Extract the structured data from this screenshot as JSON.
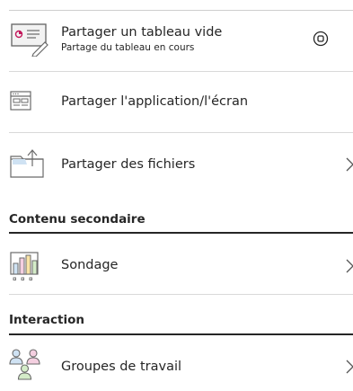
{
  "share": {
    "items": [
      {
        "label": "Partager un tableau vide",
        "sublabel": "Partage du tableau en cours",
        "icon": "whiteboard-icon",
        "action_icon": "stop-sharing-icon"
      },
      {
        "label": "Partager l'application/l'écran",
        "icon": "application-window-icon"
      },
      {
        "label": "Partager des fichiers",
        "icon": "folder-upload-icon",
        "action_icon": "chevron-right-icon"
      }
    ]
  },
  "secondary_content": {
    "heading": "Contenu secondaire",
    "items": [
      {
        "label": "Sondage",
        "icon": "poll-chart-icon",
        "action_icon": "chevron-right-icon"
      }
    ]
  },
  "interaction": {
    "heading": "Interaction",
    "items": [
      {
        "label": "Groupes de travail",
        "icon": "breakout-groups-icon",
        "action_icon": "chevron-right-icon"
      }
    ]
  },
  "colors": {
    "text": "#262626",
    "separator": "#d9d9d9",
    "accent_blue": "#cfe2f3",
    "accent_pink": "#f4cfe0",
    "accent_green": "#d4ecc8",
    "accent_yellow": "#f9e3a6"
  }
}
